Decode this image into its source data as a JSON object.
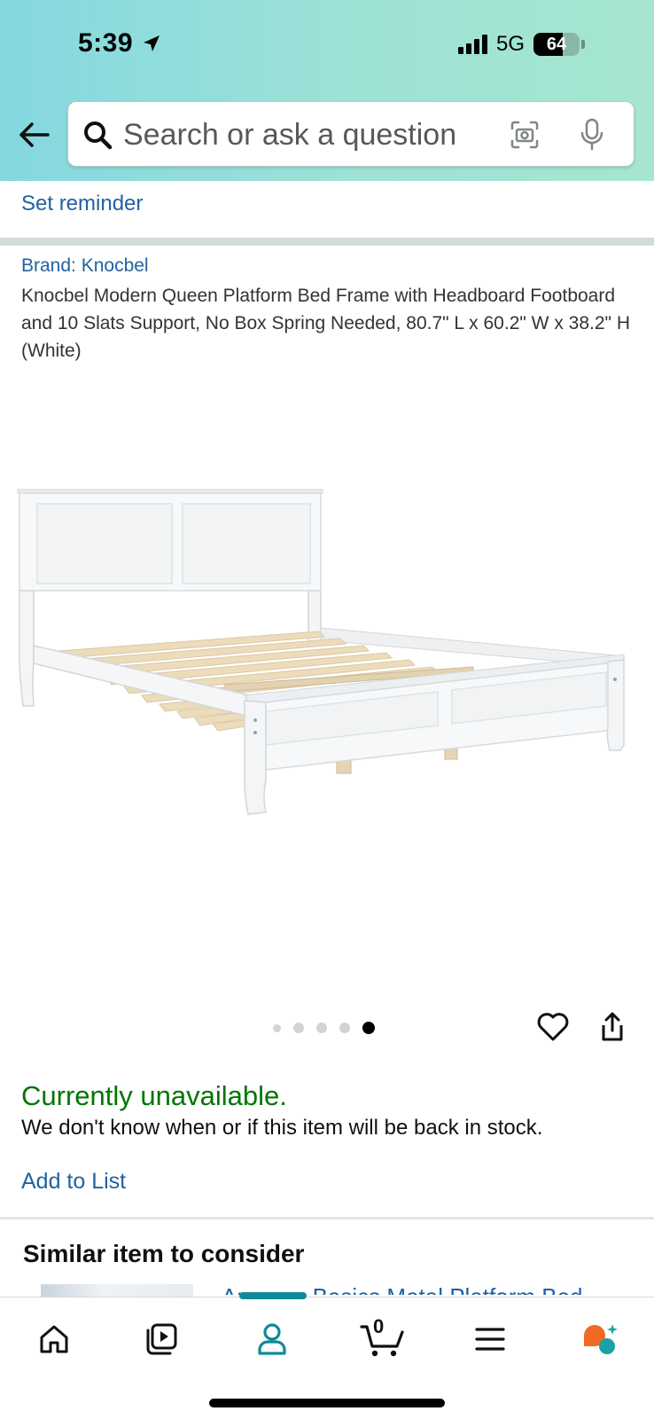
{
  "status_bar": {
    "time": "5:39",
    "network": "5G",
    "battery_level": "64",
    "battery_fraction": 0.64
  },
  "search": {
    "placeholder": "Search or ask a question"
  },
  "reminder": {
    "label": "Set reminder"
  },
  "product": {
    "brand_label": "Brand: Knocbel",
    "title": "Knocbel Modern Queen Platform Bed Frame with Headboard Footboard and 10 Slats Support, No Box Spring Needed, 80.7\" L x 60.2\" W x 38.2\" H (White)",
    "image_icon": "white-queen-bed-frame-image",
    "carousel_count": 5,
    "carousel_active_index": 4
  },
  "availability": {
    "status": "Currently unavailable.",
    "message": "We don't know when or if this item will be back in stock.",
    "add_to_list_label": "Add to List"
  },
  "similar": {
    "heading": "Similar item to consider",
    "item_title": "Amazon Basics Metal Platform Bed"
  },
  "bottom_nav": {
    "items": [
      "home-icon",
      "video-icon",
      "profile-icon",
      "cart-icon",
      "menu-icon",
      "rufus-icon"
    ],
    "active": "profile-icon",
    "cart_count": "0"
  },
  "colors": {
    "link": "#2162a1",
    "unavailable": "#007600",
    "accent": "#0f8a96",
    "header_gradient_start": "#84d8e0",
    "header_gradient_end": "#a6e6d0"
  }
}
